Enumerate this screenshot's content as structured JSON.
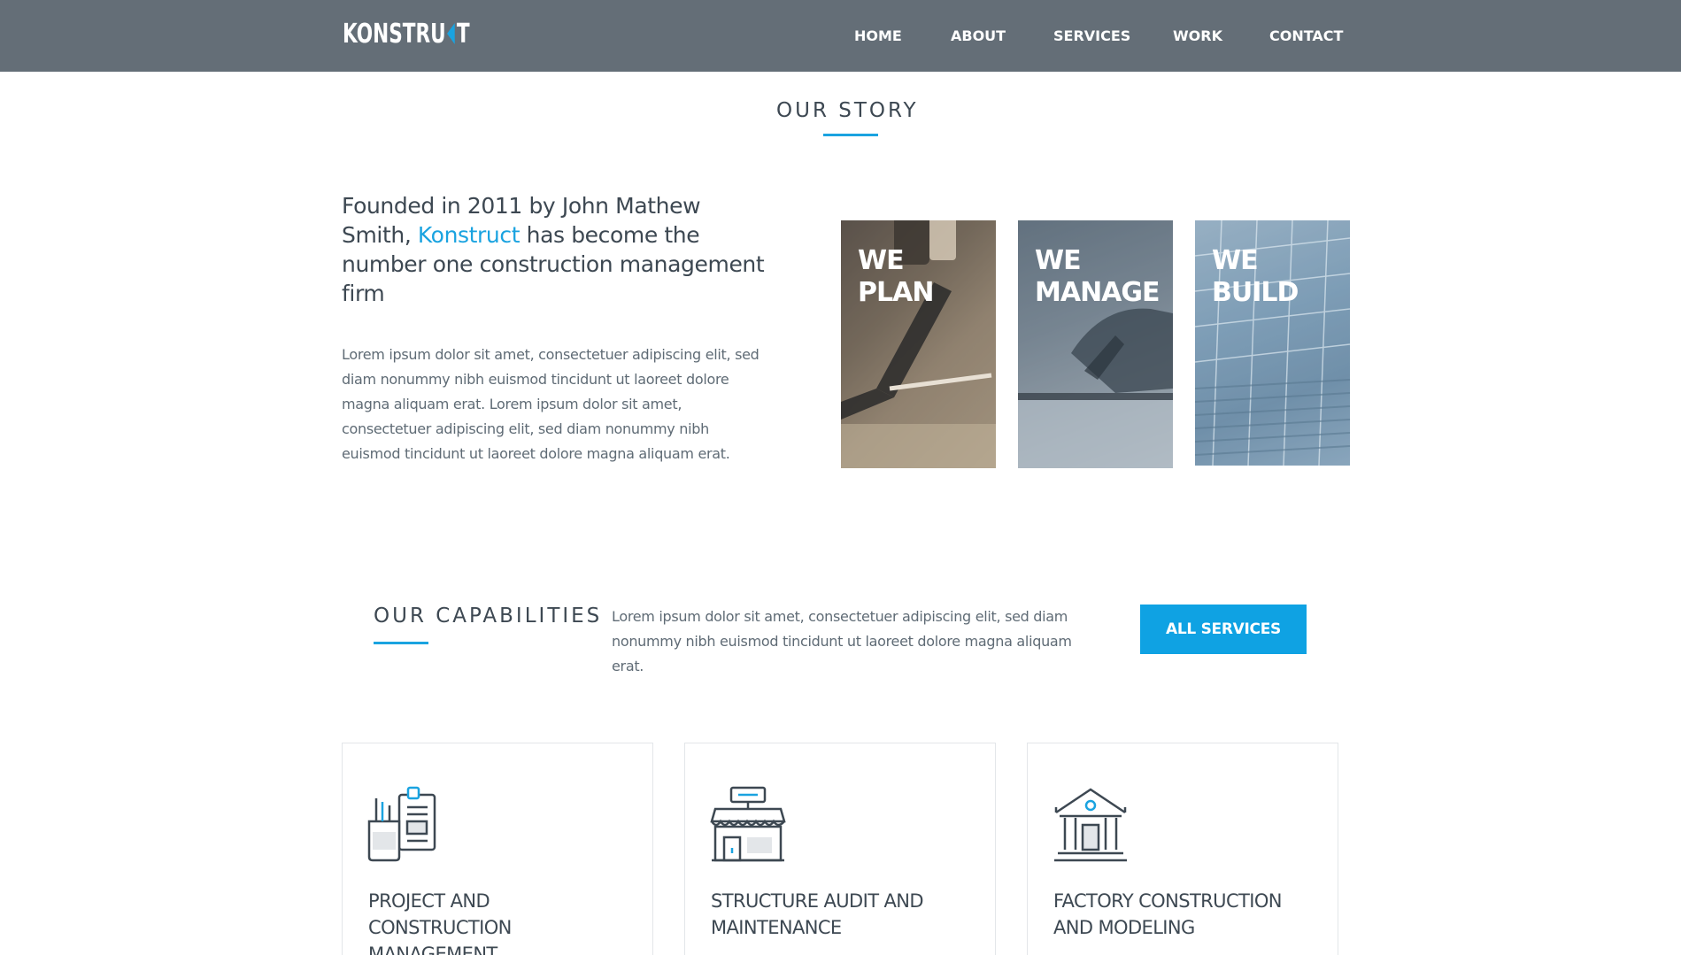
{
  "header": {
    "logo_text_left": "KONSTRU",
    "logo_text_right": "T",
    "nav": [
      "HOME",
      "ABOUT",
      "SERVICES",
      "WORK",
      "CONTACT"
    ]
  },
  "story": {
    "title": "OUR STORY",
    "lead_before": "Founded in 2011 by John Mathew Smith, ",
    "lead_accent": "Konstruct",
    "lead_after": " has become the number one construction management firm",
    "body": "Lorem ipsum dolor sit amet, consectetuer adipiscing elit, sed diam nonummy nibh euismod tincidunt ut laoreet dolore magna aliquam erat. Lorem ipsum dolor sit amet, consectetuer adipiscing elit, sed diam nonummy nibh euismod tincidunt ut laoreet dolore magna aliquam erat.",
    "tiles": [
      {
        "line1": "WE",
        "line2": "PLAN"
      },
      {
        "line1": "WE",
        "line2": "MANAGE"
      },
      {
        "line1": "WE",
        "line2": "BUILD"
      }
    ]
  },
  "capabilities": {
    "title": "OUR CAPABILITIES",
    "text": "Lorem ipsum dolor sit amet, consectetuer adipiscing elit, sed diam nonummy nibh euismod tincidunt ut laoreet dolore magna aliquam erat.",
    "button": "ALL SERVICES",
    "cards": [
      {
        "icon": "documents-pencil-cup-icon",
        "title": "PROJECT AND CONSTRUCTION MANAGEMENT"
      },
      {
        "icon": "storefront-icon",
        "title": "STRUCTURE AUDIT AND MAINTENANCE"
      },
      {
        "icon": "building-columns-icon",
        "title": "FACTORY CONSTRUCTION AND MODELING"
      }
    ]
  },
  "colors": {
    "header_bg": "#646e77",
    "accent": "#1aa3e0",
    "button_bg": "#0fa2e3",
    "text": "#3d4852"
  }
}
